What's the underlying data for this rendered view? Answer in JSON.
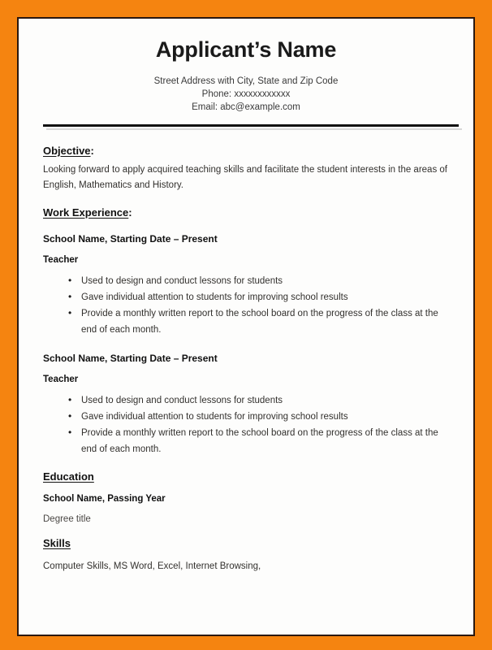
{
  "document": {
    "type": "resume-template",
    "header": {
      "name": "Applicant’s Name",
      "address": "Street Address with City, State and Zip Code",
      "phone": "Phone: xxxxxxxxxxxx",
      "email": "Email: abc@example.com"
    },
    "objective": {
      "heading": "Objective",
      "heading_colon": ":",
      "text": "Looking forward to apply acquired teaching skills and facilitate the student interests in the areas of English, Mathematics and History."
    },
    "work_experience": {
      "heading": "Work Experience",
      "heading_colon": ":",
      "jobs": [
        {
          "title": "School Name, Starting Date – Present",
          "role": "Teacher",
          "bullets": [
            "Used to design and conduct lessons for students",
            "Gave individual attention to students for improving school results",
            "Provide a monthly written report to the school board on the progress of the class at the end of each month."
          ]
        },
        {
          "title": "School Name, Starting Date – Present",
          "role": "Teacher",
          "bullets": [
            "Used to design and conduct lessons for students",
            "Gave individual attention to students for improving school results",
            "Provide a monthly written report to the school board on the progress of the class at the end of each month."
          ]
        }
      ]
    },
    "education": {
      "heading": "Education",
      "school": "School Name, Passing Year",
      "degree": "Degree title"
    },
    "skills": {
      "heading": "Skills",
      "text": "Computer Skills, MS Word, Excel, Internet Browsing,"
    }
  },
  "colors": {
    "border_orange": "#F58410",
    "inner_border": "#2b1810",
    "page_white": "#fdfdfc",
    "text_dark": "#111111",
    "text_body": "#33312e"
  }
}
